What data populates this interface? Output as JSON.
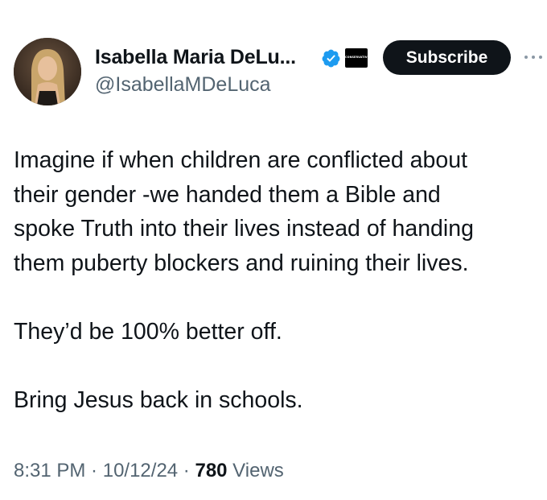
{
  "author": {
    "display_name": "Isabella Maria DeLu...",
    "handle": "@IsabellaMDeLuca",
    "verified_icon": "verified-badge-icon",
    "affiliate_badge_text": "CONSERVATIVE"
  },
  "actions": {
    "subscribe_label": "Subscribe",
    "more_icon": "more-options-icon"
  },
  "tweet": {
    "lines": [
      "Imagine if when children are conflicted about",
      "their gender -we handed them a Bible and",
      "spoke Truth into their lives instead of handing",
      "them puberty blockers and ruining their lives."
    ],
    "line_2": "They’d be 100% better off.",
    "line_3": "Bring Jesus back in schools."
  },
  "meta": {
    "time": "8:31 PM",
    "sep1": " · ",
    "date": "10/12/24",
    "sep2": " · ",
    "views_count": "780",
    "views_label": " Views"
  },
  "colors": {
    "text_primary": "#0f1419",
    "text_secondary": "#536471",
    "verified_blue": "#1d9bf0",
    "button_bg": "#0f1419"
  }
}
